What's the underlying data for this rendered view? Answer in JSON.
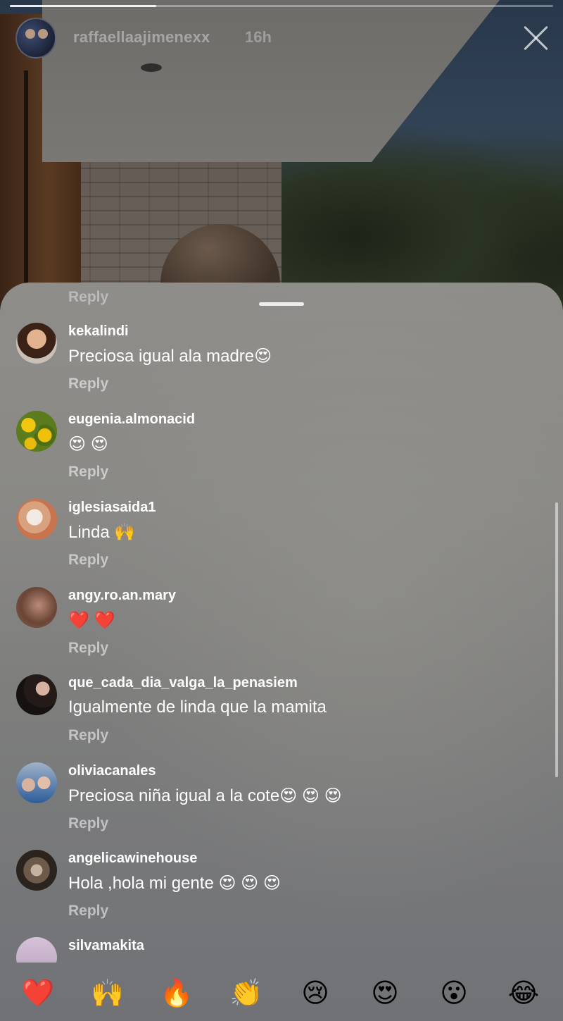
{
  "story": {
    "username": "raffaellaajimenexx",
    "time": "16h",
    "progress": 0.27
  },
  "sheet": {
    "top_reply": "Reply",
    "comments": [
      {
        "username": "kekalindi",
        "text": "Preciosa igual ala madre😍",
        "reply": "Reply"
      },
      {
        "username": "eugenia.almonacid",
        "text": "😍 😍",
        "reply": "Reply"
      },
      {
        "username": "iglesiasaida1",
        "text": "Linda 🙌",
        "reply": "Reply"
      },
      {
        "username": "angy.ro.an.mary",
        "text": "❤️ ❤️",
        "reply": "Reply"
      },
      {
        "username": "que_cada_dia_valga_la_penasiem",
        "text": "Igualmente de linda que la mamita",
        "reply": "Reply"
      },
      {
        "username": "oliviacanales",
        "text": "Preciosa niña igual a la cote😍 😍 😍",
        "reply": "Reply"
      },
      {
        "username": "angelicawinehouse",
        "text": "Hola ,hola mi gente 😍 😍 😍",
        "reply": "Reply"
      },
      {
        "username": "silvamakita",
        "text": "",
        "reply": ""
      }
    ],
    "reactions": [
      "❤️",
      "🙌",
      "🔥",
      "👏",
      "😢",
      "😍",
      "😮",
      "😂"
    ]
  }
}
